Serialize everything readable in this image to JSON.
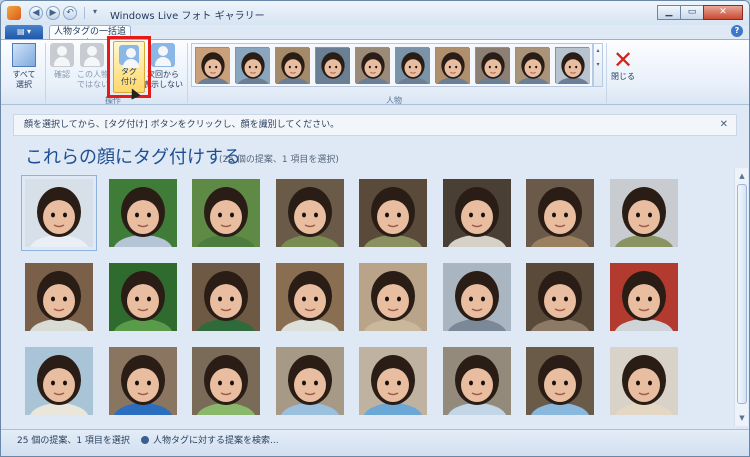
{
  "window": {
    "title": "Windows Live フォト ギャラリー"
  },
  "tabs": {
    "app_menu": "▤ ▾",
    "context_tab": "人物タグの一括追加"
  },
  "ribbon": {
    "select_all": "すべて\n選択",
    "confirm": "確認",
    "not_this_person": "この人物\nではない",
    "tag": "タグ\n付け",
    "dont_show_next": "次回から\n表示しない",
    "group_operations": "操作",
    "group_people": "人物",
    "close": "閉じる"
  },
  "info": {
    "message": "顔を選択してから、[タグ付け] ボタンをクリックし、顔を識別してください。"
  },
  "main": {
    "heading": "これらの顔にタグ付けする",
    "subheading": "(25 個の提案、1 項目を選択)"
  },
  "status": {
    "left": "25 個の提案、1 項目を選択",
    "link": "人物タグに対する提案を検索..."
  },
  "people_gallery_bgs": [
    "#c9a07a",
    "#8aa6bf",
    "#a58a6a",
    "#6a7f94",
    "#9c8a78",
    "#7b93a8",
    "#b08f6d",
    "#8c7f73",
    "#a99479",
    "#b7c3cf"
  ],
  "photos": [
    {
      "bg": "#d7e0e9",
      "shirt": "#e9eff5"
    },
    {
      "bg": "#3e7c37",
      "shirt": "#b6c5d6"
    },
    {
      "bg": "#5e8a45",
      "shirt": "#4c7d3f"
    },
    {
      "bg": "#6a5a48",
      "shirt": "#7b8c52"
    },
    {
      "bg": "#5a4a3a",
      "shirt": "#8a9060"
    },
    {
      "bg": "#4a3f34",
      "shirt": "#d5d1c6"
    },
    {
      "bg": "#6b5a4a",
      "shirt": "#9a8060"
    },
    {
      "bg": "#c8ccd0",
      "shirt": "#8a9462"
    },
    {
      "bg": "#7a6048",
      "shirt": "#d9dcd4"
    },
    {
      "bg": "#2f6a2f",
      "shirt": "#5a9b4a"
    },
    {
      "bg": "#6e5a44",
      "shirt": "#2e6a3a"
    },
    {
      "bg": "#8a6e52",
      "shirt": "#dce0d8"
    },
    {
      "bg": "#b9a48a",
      "shirt": "#c9b89c"
    },
    {
      "bg": "#a9b6c2",
      "shirt": "#7a8898"
    },
    {
      "bg": "#5a4a3a",
      "shirt": "#8c7a66"
    },
    {
      "bg": "#b23a2e",
      "shirt": "#cfd4d8"
    },
    {
      "bg": "#a9c4d6",
      "shirt": "#e9e6dc"
    },
    {
      "bg": "#8a7660",
      "shirt": "#2b6ec0"
    },
    {
      "bg": "#7a6a58",
      "shirt": "#8ab86a"
    },
    {
      "bg": "#a69a86",
      "shirt": "#9ac0de"
    },
    {
      "bg": "#c0b2a0",
      "shirt": "#6ca8d6"
    },
    {
      "bg": "#948a7c",
      "shirt": "#c2d6e8"
    },
    {
      "bg": "#6a5a48",
      "shirt": "#8ab8dc"
    },
    {
      "bg": "#d8d2c8",
      "shirt": "#e4d8c4"
    }
  ]
}
